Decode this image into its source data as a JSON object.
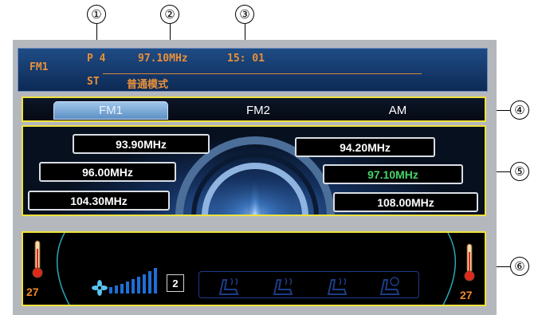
{
  "callouts": {
    "c1": "①",
    "c2": "②",
    "c3": "③",
    "c4": "④",
    "c5": "⑤",
    "c6": "⑥"
  },
  "status": {
    "band": "FM1",
    "preset": "P 4",
    "frequency": "97.10MHz",
    "time": "15: 01",
    "stereo": "ST",
    "mode": "普通模式"
  },
  "tabs": [
    "FM1",
    "FM2",
    "AM"
  ],
  "presets": {
    "left": [
      "93.90MHz",
      "96.00MHz",
      "104.30MHz"
    ],
    "right": [
      "94.20MHz",
      "97.10MHz",
      "108.00MHz"
    ]
  },
  "climate": {
    "left_temp": "27",
    "right_temp": "27",
    "fan_level": "2",
    "fan_icon": "fan-icon",
    "seat_icons": [
      "seat-heat-icon",
      "seat-heat-icon",
      "seat-heat-icon",
      "seat-vent-icon"
    ]
  },
  "colors": {
    "accent_text": "#e9903a",
    "selected_preset": "#46d36a",
    "highlight_border": "#f0e23c"
  }
}
